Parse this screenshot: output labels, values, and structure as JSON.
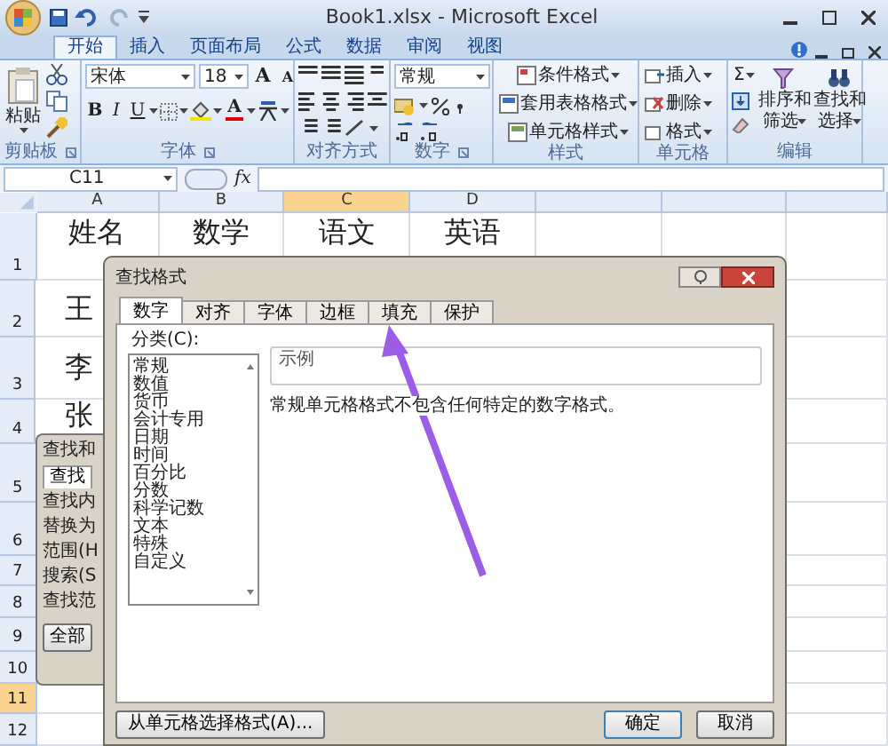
{
  "window": {
    "title": "Book1.xlsx - Microsoft Excel"
  },
  "ribbon_tabs": [
    {
      "label": "开始",
      "selected": true
    },
    {
      "label": "插入",
      "selected": false
    },
    {
      "label": "页面布局",
      "selected": false
    },
    {
      "label": "公式",
      "selected": false
    },
    {
      "label": "数据",
      "selected": false
    },
    {
      "label": "审阅",
      "selected": false
    },
    {
      "label": "视图",
      "selected": false
    }
  ],
  "ribbon": {
    "paste": "粘贴",
    "font_name": "宋体",
    "font_size": "18",
    "size_buttons": [
      "A",
      "A"
    ],
    "format_buttons": [
      "B",
      "I",
      "U"
    ],
    "font_color": "A",
    "number_format": "常规",
    "style_buttons": [
      "条件格式",
      "套用表格格式",
      "单元格样式"
    ],
    "cell_buttons": [
      "插入",
      "删除",
      "格式"
    ],
    "sum": "Σ",
    "edit_buttons": [
      {
        "line1": "排序和",
        "line2": "筛选"
      },
      {
        "line1": "查找和",
        "line2": "选择"
      }
    ],
    "groups": [
      "剪贴板",
      "字体",
      "对齐方式",
      "数字",
      "样式",
      "单元格",
      "编辑"
    ]
  },
  "formula_bar": {
    "name_box": "C11",
    "fx": "fx"
  },
  "sheet": {
    "columns": [
      {
        "label": "A",
        "selected": false
      },
      {
        "label": "B",
        "selected": false
      },
      {
        "label": "C",
        "selected": true
      },
      {
        "label": "D",
        "selected": false
      }
    ],
    "rows": [
      {
        "label": "1",
        "selected": false,
        "cells": [
          "姓名",
          "数学",
          "语文",
          "英语"
        ]
      },
      {
        "label": "2",
        "selected": false,
        "cells": [
          "王"
        ]
      },
      {
        "label": "3",
        "selected": false,
        "cells": [
          "李"
        ]
      },
      {
        "label": "4",
        "selected": false,
        "cells": [
          "张"
        ]
      },
      {
        "label": "5",
        "selected": false,
        "cells": []
      },
      {
        "label": "6",
        "selected": false,
        "cells": []
      },
      {
        "label": "7",
        "selected": false,
        "cells": []
      },
      {
        "label": "8",
        "selected": false,
        "cells": []
      },
      {
        "label": "9",
        "selected": false,
        "cells": []
      },
      {
        "label": "10",
        "selected": false,
        "cells": []
      },
      {
        "label": "11",
        "selected": true,
        "cells": []
      },
      {
        "label": "12",
        "selected": false,
        "cells": []
      }
    ]
  },
  "back_dialog": {
    "title": "查找和",
    "tab": "查找",
    "labels": [
      "查找内",
      "替换为",
      "范围(H",
      "搜索(S",
      "查找范"
    ],
    "button": "全部"
  },
  "dialog": {
    "title": "查找格式",
    "tabs": [
      {
        "label": "数字",
        "selected": true
      },
      {
        "label": "对齐",
        "selected": false
      },
      {
        "label": "字体",
        "selected": false
      },
      {
        "label": "边框",
        "selected": false
      },
      {
        "label": "填充",
        "selected": false
      },
      {
        "label": "保护",
        "selected": false
      }
    ],
    "category_label": "分类(C):",
    "categories": [
      {
        "label": "常规",
        "selected": false
      },
      {
        "label": "数值",
        "selected": false
      },
      {
        "label": "货币",
        "selected": false
      },
      {
        "label": "会计专用",
        "selected": false
      },
      {
        "label": "日期",
        "selected": false
      },
      {
        "label": "时间",
        "selected": false
      },
      {
        "label": "百分比",
        "selected": false
      },
      {
        "label": "分数",
        "selected": false
      },
      {
        "label": "科学记数",
        "selected": false
      },
      {
        "label": "文本",
        "selected": false
      },
      {
        "label": "特殊",
        "selected": false
      },
      {
        "label": "自定义",
        "selected": false
      }
    ],
    "sample_label": "示例",
    "description": "常规单元格格式不包含任何特定的数字格式。",
    "pick_button": "从单元格选择格式(A)...",
    "ok": "确定",
    "cancel": "取消"
  }
}
